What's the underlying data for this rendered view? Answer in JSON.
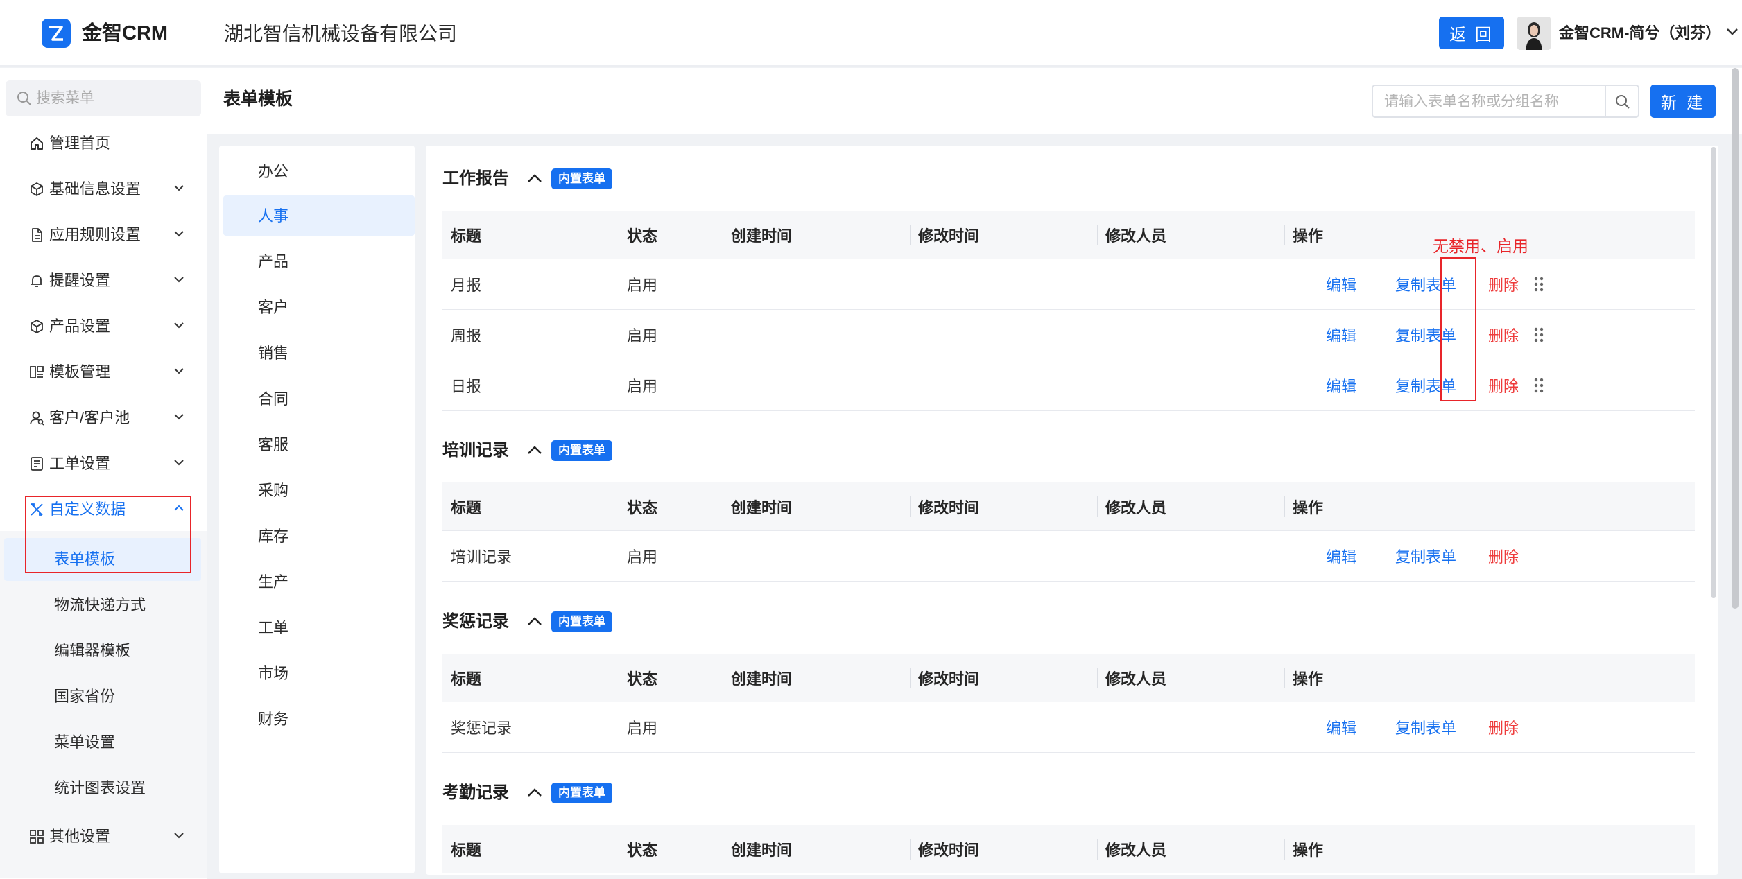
{
  "header": {
    "brand": "金智CRM",
    "company": "湖北智信机械设备有限公司",
    "back_label": "返 回",
    "user_name": "金智CRM-简兮（刘芬）"
  },
  "sidebar": {
    "search_placeholder": "搜索菜单",
    "items": [
      {
        "label": "管理首页",
        "icon": "home-icon"
      },
      {
        "label": "基础信息设置",
        "icon": "cube-icon"
      },
      {
        "label": "应用规则设置",
        "icon": "document-icon"
      },
      {
        "label": "提醒设置",
        "icon": "bell-icon"
      },
      {
        "label": "产品设置",
        "icon": "cube-icon"
      },
      {
        "label": "模板管理",
        "icon": "layout-icon"
      },
      {
        "label": "客户/客户池",
        "icon": "user-icon"
      },
      {
        "label": "工单设置",
        "icon": "ticket-icon"
      },
      {
        "label": "自定义数据",
        "icon": "tools-icon"
      },
      {
        "label": "其他设置",
        "icon": "grid-icon"
      }
    ],
    "sub_items": [
      {
        "label": "表单模板"
      },
      {
        "label": "物流快递方式"
      },
      {
        "label": "编辑器模板"
      },
      {
        "label": "国家省份"
      },
      {
        "label": "菜单设置"
      },
      {
        "label": "统计图表设置"
      }
    ]
  },
  "content": {
    "title": "表单模板",
    "search_placeholder": "请输入表单名称或分组名称",
    "new_label": "新 建"
  },
  "categories": [
    "办公",
    "人事",
    "产品",
    "客户",
    "销售",
    "合同",
    "客服",
    "采购",
    "库存",
    "生产",
    "工单",
    "市场",
    "财务"
  ],
  "table_columns": {
    "title": "标题",
    "status": "状态",
    "created": "创建时间",
    "modified": "修改时间",
    "modifier": "修改人员",
    "ops": "操作"
  },
  "actions": {
    "edit": "编辑",
    "copy": "复制表单",
    "delete": "删除"
  },
  "sections": [
    {
      "title": "工作报告",
      "badge": "内置表单",
      "rows": [
        {
          "title": "月报",
          "status": "启用",
          "created": "",
          "modified": "",
          "modifier": ""
        },
        {
          "title": "周报",
          "status": "启用",
          "created": "",
          "modified": "",
          "modifier": ""
        },
        {
          "title": "日报",
          "status": "启用",
          "created": "",
          "modified": "",
          "modifier": ""
        }
      ]
    },
    {
      "title": "培训记录",
      "badge": "内置表单",
      "rows": [
        {
          "title": "培训记录",
          "status": "启用",
          "created": "",
          "modified": "",
          "modifier": ""
        }
      ]
    },
    {
      "title": "奖惩记录",
      "badge": "内置表单",
      "rows": [
        {
          "title": "奖惩记录",
          "status": "启用",
          "created": "",
          "modified": "",
          "modifier": ""
        }
      ]
    },
    {
      "title": "考勤记录",
      "badge": "内置表单",
      "rows": []
    }
  ],
  "annotation": {
    "note": "无禁用、启用"
  },
  "colors": {
    "accent": "#1670f0",
    "danger": "#ee3b3b",
    "annotation": "#e8252a"
  }
}
